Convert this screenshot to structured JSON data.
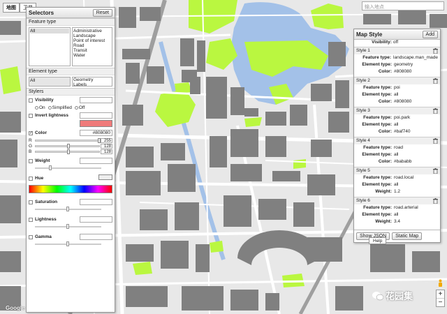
{
  "map": {
    "colors": {
      "land": "#e8e8e8",
      "buildings": "#808080",
      "park": "#baf740",
      "road": "#ffffff",
      "water": "#a3c1e8",
      "highway": "#9f9f9f"
    },
    "type_tabs": [
      "地图",
      "卫星"
    ],
    "search_placeholder": "输入地点"
  },
  "selectors": {
    "title": "Selectors",
    "reset_label": "Reset",
    "feature_type_heading": "Feature type",
    "feature_type_all": "All",
    "feature_types": [
      "Administrative",
      "Landscape",
      "Point of interest",
      "Road",
      "Transit",
      "Water"
    ],
    "element_type_heading": "Element type",
    "element_type_all": "All",
    "element_types": [
      "Geometry",
      "Labels"
    ],
    "stylers_heading": "Stylers",
    "visibility_label": "Visibility",
    "visibility_options": [
      "On",
      "Simplified",
      "Off"
    ],
    "invert_label": "Invert lightness",
    "color_label": "Color",
    "color_value": "#808080",
    "color_swatch": "#ef7b7b",
    "rgb": [
      {
        "channel": "R",
        "value": "255",
        "fraction": 1.0
      },
      {
        "channel": "G",
        "value": "128",
        "fraction": 0.5
      },
      {
        "channel": "B",
        "value": "128",
        "fraction": 0.5
      }
    ],
    "weight_label": "Weight",
    "hue_label": "Hue",
    "saturation_label": "Saturation",
    "lightness_label": "Lightness",
    "gamma_label": "Gamma"
  },
  "map_style": {
    "title": "Map Style",
    "add_label": "Add",
    "visibility_label": "Visibility:",
    "visibility_value": "off",
    "styles": [
      {
        "name": "Style 1",
        "props": [
          [
            "Feature type:",
            "landscape.man_made"
          ],
          [
            "Element type:",
            "geometry"
          ],
          [
            "Color:",
            "#808080"
          ]
        ]
      },
      {
        "name": "Style 2",
        "props": [
          [
            "Feature type:",
            "poi"
          ],
          [
            "Element type:",
            "all"
          ],
          [
            "Color:",
            "#808080"
          ]
        ]
      },
      {
        "name": "Style 3",
        "props": [
          [
            "Feature type:",
            "poi.park"
          ],
          [
            "Element type:",
            "all"
          ],
          [
            "Color:",
            "#baf740"
          ]
        ]
      },
      {
        "name": "Style 4",
        "props": [
          [
            "Feature type:",
            "road"
          ],
          [
            "Element type:",
            "all"
          ],
          [
            "Color:",
            "#bababb"
          ]
        ]
      },
      {
        "name": "Style 5",
        "props": [
          [
            "Feature type:",
            "road.local"
          ],
          [
            "Element type:",
            "all"
          ],
          [
            "Weight:",
            "1.2"
          ]
        ]
      },
      {
        "name": "Style 6",
        "props": [
          [
            "Feature type:",
            "road.arterial"
          ],
          [
            "Element type:",
            "all"
          ],
          [
            "Weight:",
            "3.4"
          ]
        ]
      }
    ],
    "show_json_label": "Show JSON",
    "static_map_label": "Static Map",
    "help_label": "Help"
  },
  "watermark": "花园集",
  "zoom": {
    "in": "+",
    "out": "−"
  },
  "google_mark": "Google"
}
